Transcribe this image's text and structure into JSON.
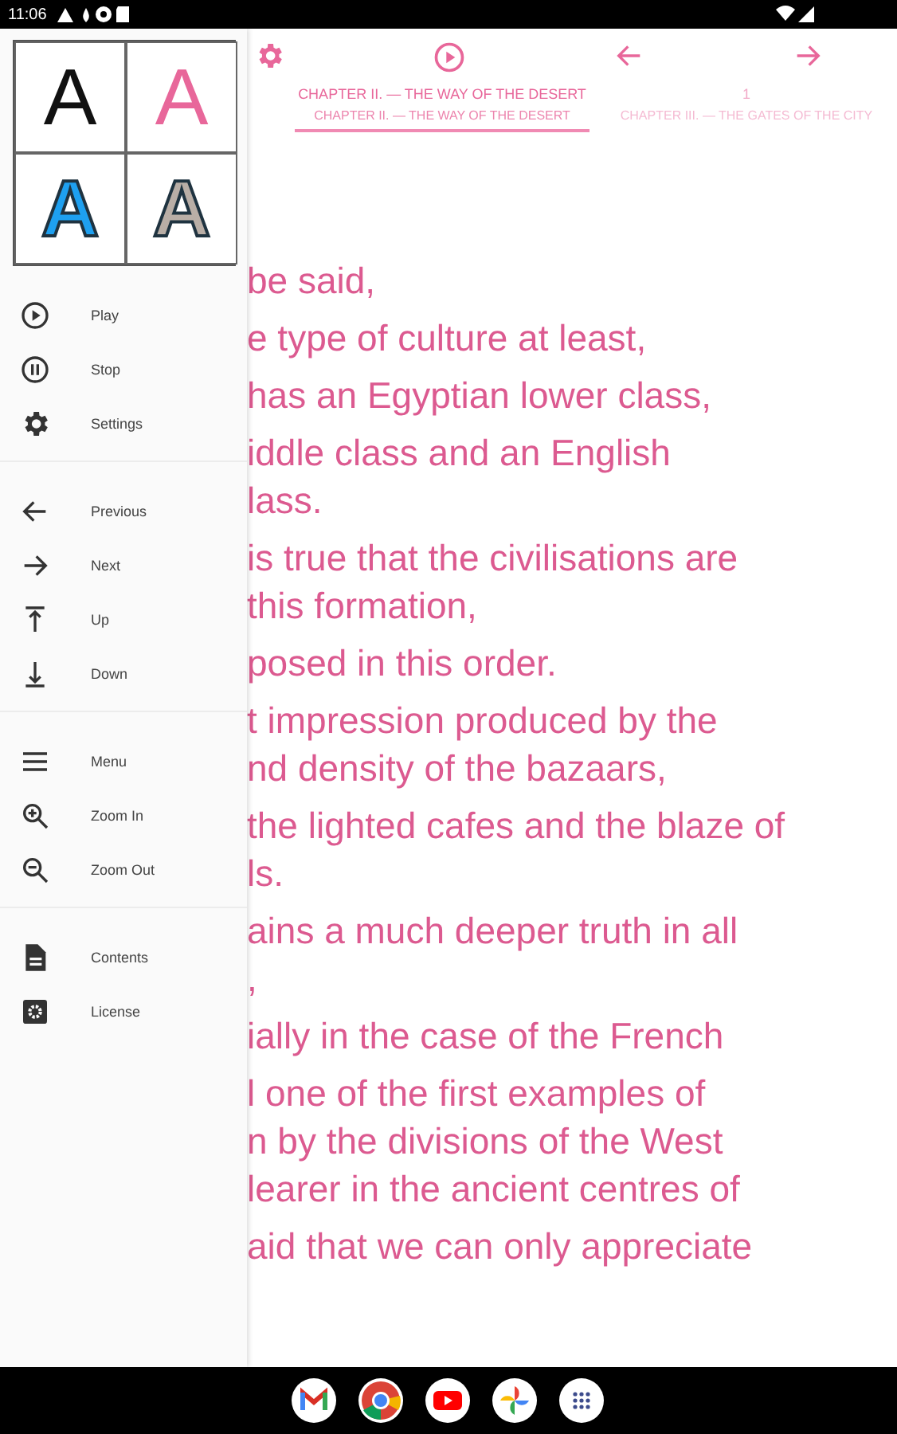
{
  "status_bar": {
    "time": "11:06"
  },
  "theme_swatches": [
    {
      "letter": "A",
      "color": "#111111",
      "kind": "plain"
    },
    {
      "letter": "A",
      "color": "#e8679a",
      "kind": "plain"
    },
    {
      "letter": "A",
      "color": "#1ea0f0",
      "kind": "outlined"
    },
    {
      "letter": "A",
      "color": "#b9aea6",
      "kind": "outlined"
    }
  ],
  "menu_groups": [
    [
      {
        "kind": "play",
        "label": "Play"
      },
      {
        "kind": "pause",
        "label": "Stop"
      },
      {
        "kind": "gear",
        "label": "Settings"
      }
    ],
    [
      {
        "kind": "left",
        "label": "Previous"
      },
      {
        "kind": "right",
        "label": "Next"
      },
      {
        "kind": "up",
        "label": "Up"
      },
      {
        "kind": "down",
        "label": "Down"
      }
    ],
    [
      {
        "kind": "menu",
        "label": "Menu"
      },
      {
        "kind": "zoomin",
        "label": "Zoom In"
      },
      {
        "kind": "zoomout",
        "label": "Zoom Out"
      }
    ],
    [
      {
        "kind": "doc",
        "label": "Contents"
      },
      {
        "kind": "gearbox",
        "label": "License"
      }
    ]
  ],
  "tabs": [
    {
      "title": "CHAPTER II. — THE WAY OF THE DESERT",
      "subtitle": "CHAPTER II. — THE WAY OF THE DESERT",
      "selected": true
    },
    {
      "title": "1",
      "subtitle": "CHAPTER III. — THE GATES OF THE CITY",
      "selected": false
    }
  ],
  "paragraphs": [
    {
      "lines": [
        "be said,"
      ]
    },
    {
      "lines": [
        "e type of culture at least,"
      ]
    },
    {
      "lines": [
        "has an Egyptian lower class,"
      ]
    },
    {
      "lines": [
        "iddle class and an English",
        "lass."
      ]
    },
    {
      "lines": [
        "is true that the civilisations are",
        "this formation,"
      ]
    },
    {
      "lines": [
        "posed in this order."
      ]
    },
    {
      "lines": [
        "t impression produced by the",
        "nd density of the bazaars,"
      ]
    },
    {
      "lines": [
        "the lighted cafes and the blaze of",
        "ls."
      ]
    },
    {
      "lines": [
        "ains a much deeper truth in all",
        ","
      ]
    },
    {
      "lines": [
        "ially in the case of the French"
      ]
    },
    {
      "lines": [
        "l one of the first examples of",
        "n by the divisions of the West",
        "learer in the ancient centres of"
      ]
    },
    {
      "lines": [
        "aid that we can only appreciate"
      ]
    }
  ],
  "dock": [
    {
      "kind": "mail"
    },
    {
      "kind": "browser"
    },
    {
      "kind": "video"
    },
    {
      "kind": "photos"
    },
    {
      "kind": "apps"
    }
  ]
}
